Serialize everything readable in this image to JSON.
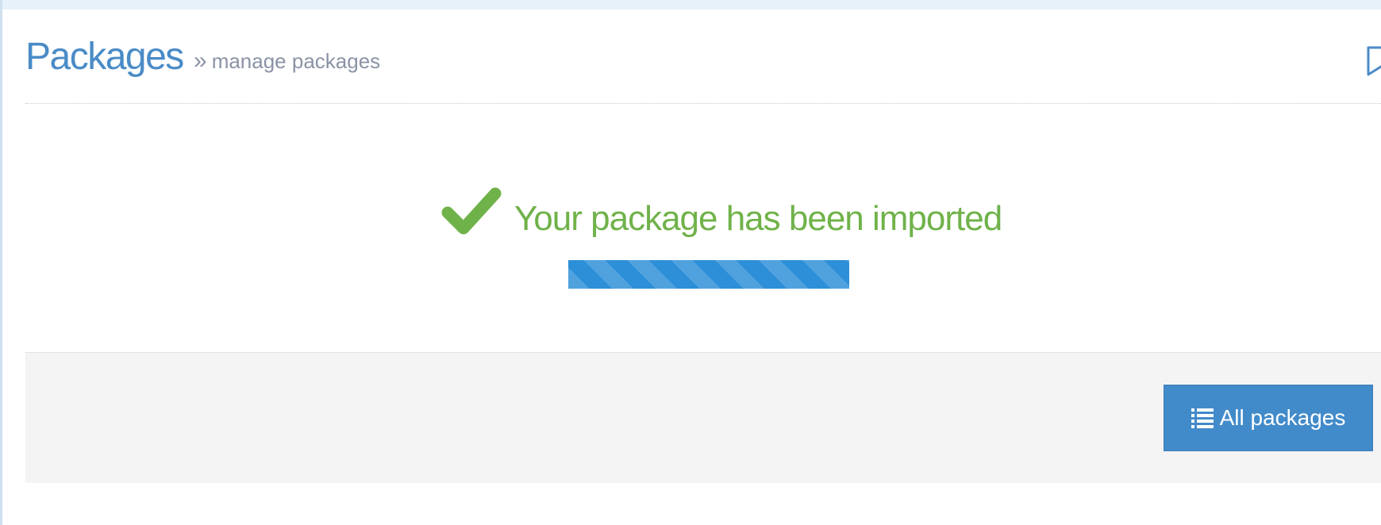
{
  "header": {
    "title": "Packages",
    "breadcrumb_separator": "»",
    "breadcrumb": "manage packages",
    "bookmark_icon": "bookmark-icon"
  },
  "status": {
    "icon": "check-icon",
    "message": "Your package has been imported",
    "color": "#70b24a"
  },
  "progress": {
    "percent": 100,
    "color": "#2d8fd8"
  },
  "footer": {
    "button_label": "All packages",
    "button_icon": "list-icon",
    "button_color": "#428bca"
  }
}
